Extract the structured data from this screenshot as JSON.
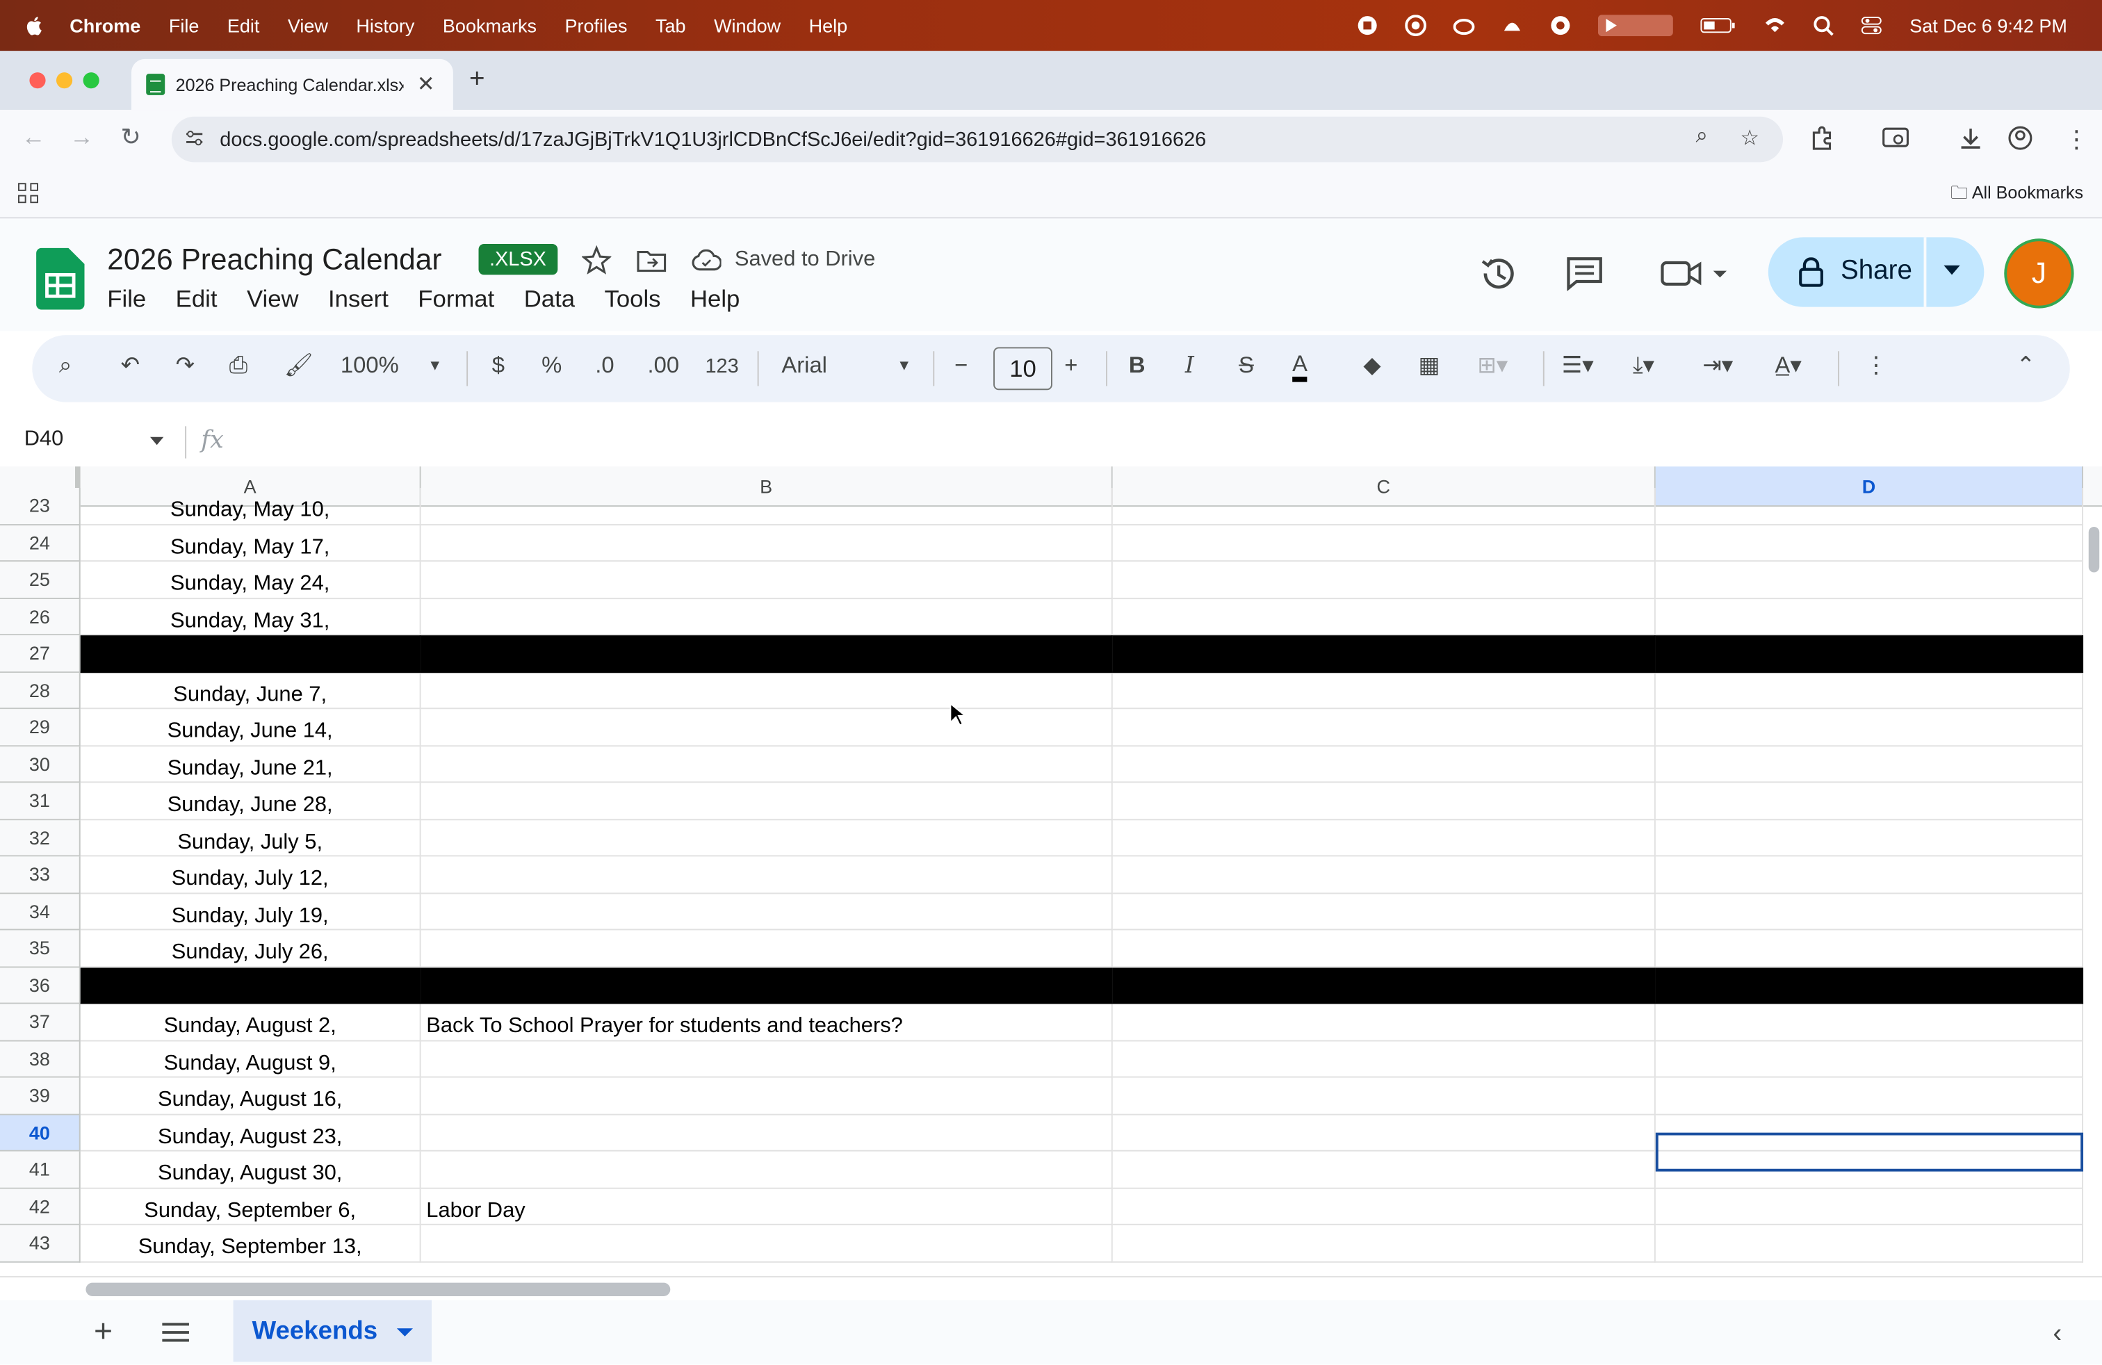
{
  "menubar": {
    "app": "Chrome",
    "items": [
      "File",
      "Edit",
      "View",
      "History",
      "Bookmarks",
      "Profiles",
      "Tab",
      "Window",
      "Help"
    ],
    "clock": "Sat Dec 6  9:42 PM"
  },
  "browser": {
    "tab_title": "2026 Preaching Calendar.xlsx",
    "url": "docs.google.com/spreadsheets/d/17zaJGjBjTrkV1Q1U3jrlCDBnCfScJ6ei/edit?gid=361916626#gid=361916626",
    "bookmarks_label": "All Bookmarks"
  },
  "doc": {
    "title": "2026 Preaching Calendar",
    "badge": ".XLSX",
    "saved_status": "Saved to Drive",
    "menus": [
      "File",
      "Edit",
      "View",
      "Insert",
      "Format",
      "Data",
      "Tools",
      "Help"
    ],
    "share_label": "Share",
    "avatar_letter": "J"
  },
  "toolbar": {
    "zoom": "100%",
    "currency": "$",
    "percent": "%",
    "dec_decrease": ".0",
    "dec_increase": ".00",
    "number_format": "123",
    "font": "Arial",
    "font_size": "10"
  },
  "formula_bar": {
    "cell_ref": "D40",
    "fx": "fx"
  },
  "columns": [
    "A",
    "B",
    "C",
    "D"
  ],
  "selected_column": "D",
  "selected_row": "40",
  "rows": [
    {
      "n": "23",
      "a": "Sunday, May 10,",
      "b": ""
    },
    {
      "n": "24",
      "a": "Sunday, May 17,",
      "b": ""
    },
    {
      "n": "25",
      "a": "Sunday, May 24,",
      "b": ""
    },
    {
      "n": "26",
      "a": "Sunday, May 31,",
      "b": ""
    },
    {
      "n": "27",
      "a": "",
      "b": "",
      "black": true
    },
    {
      "n": "28",
      "a": "Sunday, June 7,",
      "b": ""
    },
    {
      "n": "29",
      "a": "Sunday, June 14,",
      "b": ""
    },
    {
      "n": "30",
      "a": "Sunday, June 21,",
      "b": ""
    },
    {
      "n": "31",
      "a": "Sunday, June 28,",
      "b": ""
    },
    {
      "n": "32",
      "a": "Sunday, July 5,",
      "b": ""
    },
    {
      "n": "33",
      "a": "Sunday, July 12,",
      "b": ""
    },
    {
      "n": "34",
      "a": "Sunday, July 19,",
      "b": ""
    },
    {
      "n": "35",
      "a": "Sunday, July 26,",
      "b": ""
    },
    {
      "n": "36",
      "a": "",
      "b": "",
      "black": true
    },
    {
      "n": "37",
      "a": "Sunday, August 2,",
      "b": "Back To School Prayer for students and teachers?"
    },
    {
      "n": "38",
      "a": "Sunday, August 9,",
      "b": ""
    },
    {
      "n": "39",
      "a": "Sunday, August 16,",
      "b": ""
    },
    {
      "n": "40",
      "a": "Sunday, August 23,",
      "b": ""
    },
    {
      "n": "41",
      "a": "Sunday, August 30,",
      "b": ""
    },
    {
      "n": "42",
      "a": "Sunday, September 6,",
      "b": "Labor Day"
    },
    {
      "n": "43",
      "a": "Sunday, September 13,",
      "b": ""
    }
  ],
  "sheet_tab": "Weekends"
}
